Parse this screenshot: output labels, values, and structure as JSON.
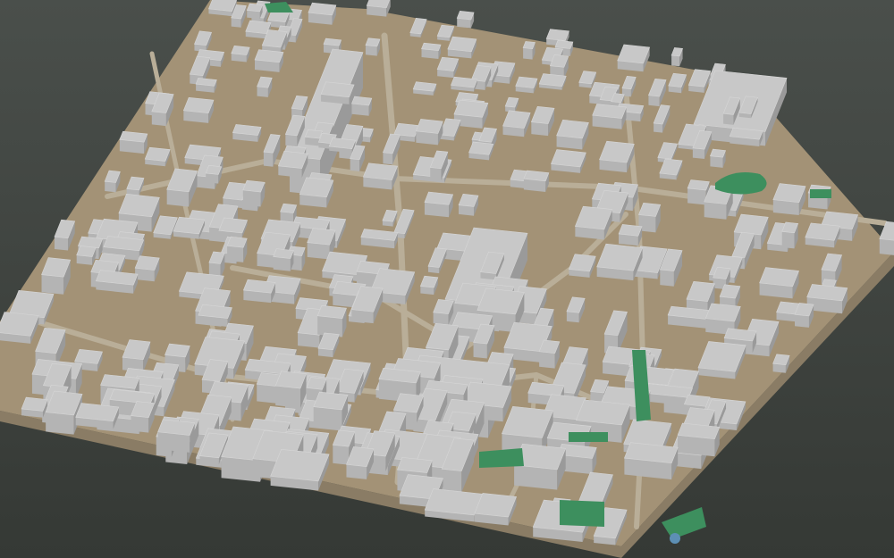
{
  "scene": {
    "subject": "3d-city-block-model",
    "colors": {
      "background_top": "#4a4f4b",
      "background_bottom": "#353935",
      "ground": "#a39276",
      "base_side": "#8a7c65",
      "roof": "#c8c8c8",
      "wall_light": "#b4b4b4",
      "wall_dark": "#9a9a9a",
      "park": "#3d8f5e",
      "water": "#5d8fb4"
    }
  }
}
